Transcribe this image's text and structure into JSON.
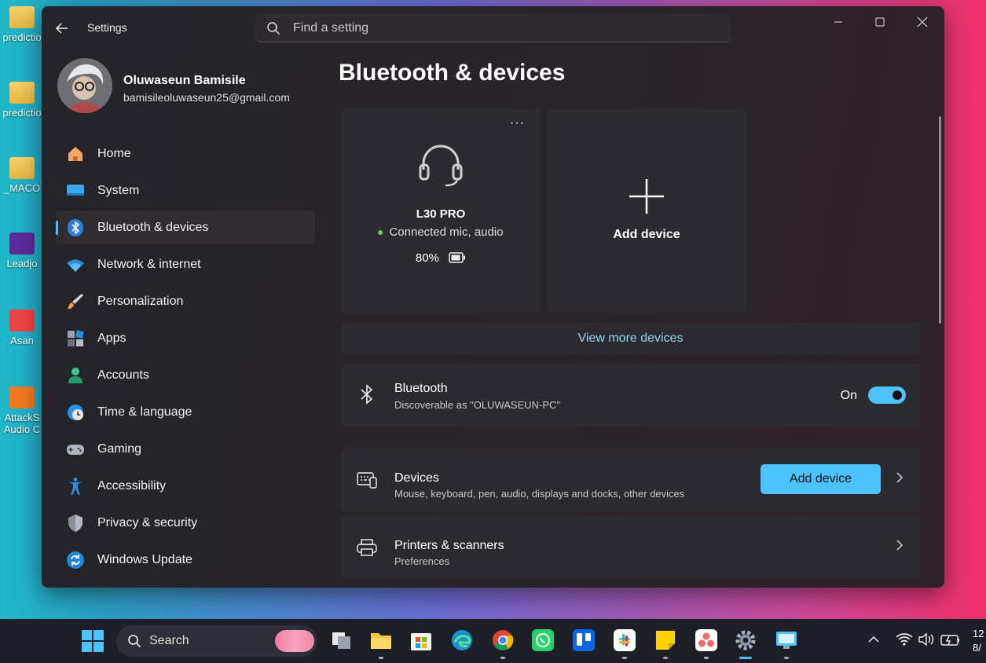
{
  "desktop": {
    "icons": [
      {
        "label": "predictio",
        "kind": "folder"
      },
      {
        "label": "predictio",
        "kind": "folder"
      },
      {
        "label": "_MACO",
        "kind": "folder"
      },
      {
        "label": "Leadjo",
        "kind": "app"
      },
      {
        "label": "Asan",
        "kind": "app"
      },
      {
        "label": "AttackS Audio C",
        "kind": "app"
      }
    ]
  },
  "window": {
    "title": "Settings",
    "search_placeholder": "Find a setting"
  },
  "profile": {
    "name": "Oluwaseun Bamisile",
    "email": "bamisileoluwaseun25@gmail.com"
  },
  "nav": [
    {
      "label": "Home",
      "icon": "home-icon"
    },
    {
      "label": "System",
      "icon": "system-icon"
    },
    {
      "label": "Bluetooth & devices",
      "icon": "bluetooth-icon",
      "active": true
    },
    {
      "label": "Network & internet",
      "icon": "wifi-icon"
    },
    {
      "label": "Personalization",
      "icon": "brush-icon"
    },
    {
      "label": "Apps",
      "icon": "apps-icon"
    },
    {
      "label": "Accounts",
      "icon": "accounts-icon"
    },
    {
      "label": "Time & language",
      "icon": "globe-clock-icon"
    },
    {
      "label": "Gaming",
      "icon": "gamepad-icon"
    },
    {
      "label": "Accessibility",
      "icon": "accessibility-icon"
    },
    {
      "label": "Privacy & security",
      "icon": "shield-icon"
    },
    {
      "label": "Windows Update",
      "icon": "update-icon"
    }
  ],
  "page": {
    "title": "Bluetooth & devices",
    "device": {
      "name": "L30 PRO",
      "status": "Connected mic, audio",
      "battery": "80%",
      "more": "···"
    },
    "add_device_card": "Add device",
    "view_more": "View more devices",
    "bluetooth": {
      "title": "Bluetooth",
      "subtitle": "Discoverable as \"OLUWASEUN-PC\"",
      "state_label": "On"
    },
    "devices": {
      "title": "Devices",
      "subtitle": "Mouse, keyboard, pen, audio, displays and docks, other devices",
      "button": "Add device"
    },
    "printers": {
      "title": "Printers & scanners",
      "subtitle": "Preferences"
    }
  },
  "taskbar": {
    "search_label": "Search",
    "apps": [
      "task-view",
      "file-explorer",
      "microsoft-store",
      "edge",
      "chrome",
      "whatsapp",
      "trello",
      "slack",
      "sticky-notes",
      "asana",
      "settings",
      "remote-desktop"
    ],
    "active_app": "settings",
    "clock_line1": "12",
    "clock_line2": "8/"
  },
  "colors": {
    "accent": "#4cc2ff",
    "connected": "#6ccb5f"
  }
}
